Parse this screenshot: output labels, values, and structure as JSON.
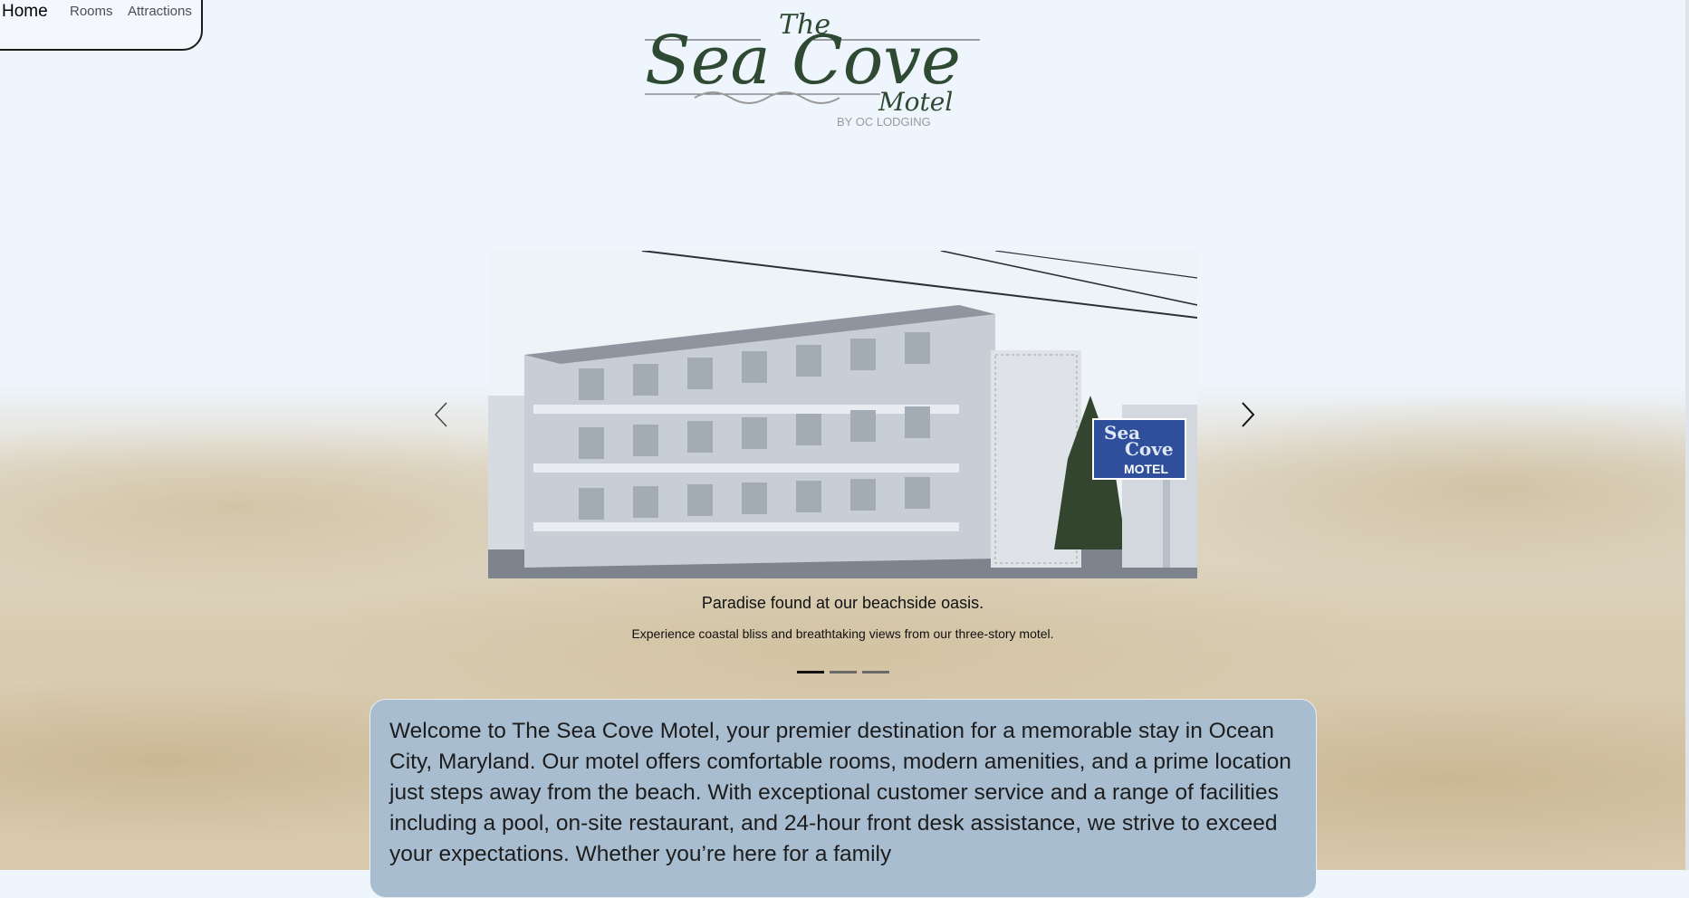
{
  "nav": {
    "items": [
      {
        "label": "Home",
        "active": true
      },
      {
        "label": "Rooms",
        "active": false
      },
      {
        "label": "Attractions",
        "active": false
      }
    ]
  },
  "logo": {
    "line1": "The",
    "line2": "Sea Cove",
    "line3": "Motel",
    "tagline": "BY OC LODGING",
    "color": "#2f4a33"
  },
  "carousel": {
    "slide_sign_line1": "Sea",
    "slide_sign_line2": "Cove",
    "slide_sign_line3": "MOTEL",
    "caption_title": "Paradise found at our beachside oasis.",
    "caption_subtitle": "Experience coastal bliss and breathtaking views from our three-story motel.",
    "indicator_count": 3,
    "active_index": 0,
    "prev_icon": "chevron-left-icon",
    "next_icon": "chevron-right-icon"
  },
  "welcome": {
    "text": "Welcome to The Sea Cove Motel, your premier destination for a memorable stay in Ocean City, Maryland. Our motel offers comfortable rooms, modern amenities, and a prime location just steps away from the beach. With exceptional customer service and a range of facilities including a pool, on-site restaurant, and 24-hour front desk assistance, we strive to exceed your expectations. Whether you’re here for a family"
  },
  "colors": {
    "page_bg": "#eef5fd",
    "welcome_bg": "#a9bdd0",
    "sign_blue": "#2f4f9d"
  }
}
